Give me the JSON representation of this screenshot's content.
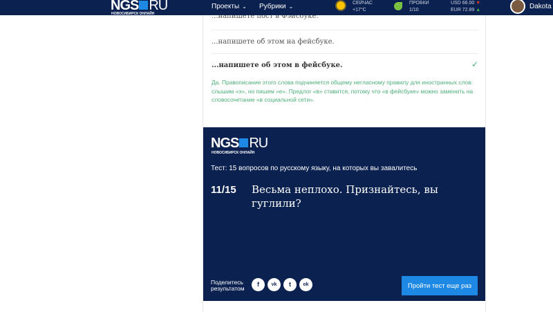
{
  "header": {
    "logo": "NGS",
    "logo_suffix": "RU",
    "logo_sub": "НОВОСИБИРСК ОНЛАЙН",
    "nav": [
      {
        "label": "Проекты"
      },
      {
        "label": "Рубрики"
      }
    ],
    "weather": {
      "label": "СЕЙЧАС",
      "value": "+17°C",
      "icon": "sun-icon"
    },
    "traffic": {
      "label": "ПРОБКИ",
      "value": "1/10",
      "icon": "traffic-icon"
    },
    "rates": {
      "usd": "USD 66.00",
      "usd_trend": "▼",
      "usd_color": "#e53935",
      "eur": "EUR 72.89",
      "eur_trend": "▲",
      "eur_color": "#4caf50"
    },
    "user": "Dakota"
  },
  "quiz": {
    "options": [
      {
        "text": "...напишете пост в Фэйсбуке."
      },
      {
        "text": "...напишете об этом на фейсбуке."
      },
      {
        "text": "...напишете об этом в фейсбуке.",
        "selected": true,
        "correct": true
      }
    ],
    "explanation": "Да. Правописание этого слова подчиняется общему негласному правилу для иностранных слов: слышим «э», но пишем «е». Предлог «в» ставится, потому что «в фейсбуке» можно заменить на словосочетание «в социальной сети».",
    "accent": "#4caf7a"
  },
  "result": {
    "logo": "NGS",
    "logo_suffix": "RU",
    "logo_sub": "НОВОСИБИРСК ОНЛАЙН",
    "title": "Тест: 15 вопросов по русскому языку, на которых вы завалитесь",
    "score": "11/15",
    "verdict": "Весьма неплохо. Признайтесь, вы гуглили?",
    "share_label": "Поделитесь результатом",
    "social": [
      {
        "icon": "facebook-icon",
        "glyph": "f"
      },
      {
        "icon": "vk-icon",
        "glyph": "vk"
      },
      {
        "icon": "twitter-icon",
        "glyph": "t"
      },
      {
        "icon": "odnoklassniki-icon",
        "glyph": "ok"
      }
    ],
    "retry": "Пройти тест еще раз",
    "bg": "#0b2150",
    "button_color": "#1e88e5"
  }
}
